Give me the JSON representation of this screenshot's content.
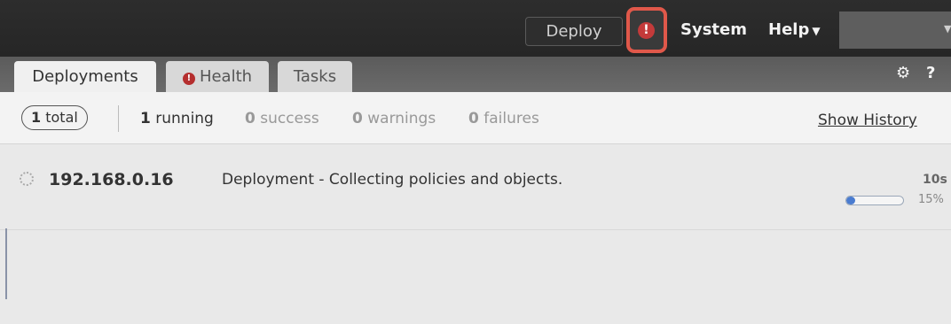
{
  "topbar": {
    "deploy_label": "Deploy",
    "alert_glyph": "!",
    "alert_icon": "exclamation-circle-icon",
    "alert_color": "#c43a3a",
    "system_label": "System",
    "help_label": "Help",
    "help_caret": "▼",
    "user_caret": "▼"
  },
  "tabs": [
    {
      "label": "Deployments",
      "active": true
    },
    {
      "label": "Health",
      "active": false,
      "icon": "exclamation-circle-icon"
    },
    {
      "label": "Tasks",
      "active": false
    }
  ],
  "tab_health_glyph": "!",
  "toolbar_icons": {
    "gear": "⚙",
    "help": "?"
  },
  "summary": {
    "total_count": "1",
    "total_label": "total",
    "running_count": "1",
    "running_label": "running",
    "success_count": "0",
    "success_label": "success",
    "warnings_count": "0",
    "warnings_label": "warnings",
    "failures_count": "0",
    "failures_label": "failures",
    "show_history_label": "Show History"
  },
  "deployments": [
    {
      "device": "192.168.0.16",
      "message": "Deployment - Collecting policies and objects.",
      "elapsed": "10s",
      "progress_percent": 15,
      "progress_label": "15%",
      "progress_color": "#4a7cd0"
    }
  ]
}
